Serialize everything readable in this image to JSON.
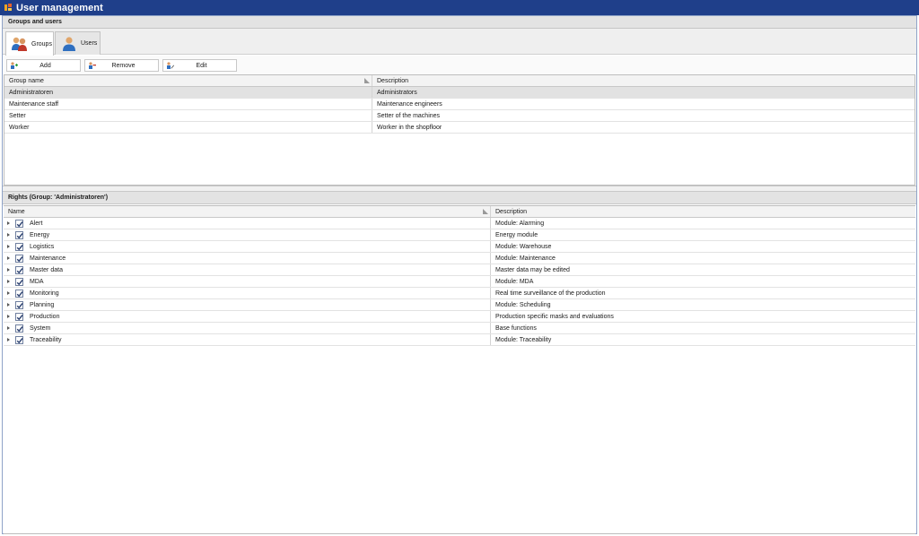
{
  "window": {
    "title": "User management"
  },
  "groups_section": {
    "header": "Groups and users"
  },
  "tabs": [
    {
      "label": "Groups",
      "icon": "users-group-icon"
    },
    {
      "label": "Users",
      "icon": "user-icon"
    }
  ],
  "toolbar": {
    "add_label": "Add",
    "remove_label": "Remove",
    "edit_label": "Edit"
  },
  "groups_table": {
    "columns": [
      "Group name",
      "Description"
    ],
    "rows": [
      {
        "name": "Administratoren",
        "description": "Administrators"
      },
      {
        "name": "Maintenance staff",
        "description": "Maintenance engineers"
      },
      {
        "name": "Setter",
        "description": "Setter of the machines"
      },
      {
        "name": "Worker",
        "description": "Worker in the shopfloor"
      }
    ]
  },
  "rights_section": {
    "header": "Rights (Group: 'Administratoren')"
  },
  "rights_table": {
    "columns": [
      "Name",
      "Description"
    ],
    "rows": [
      {
        "name": "Alert",
        "description": "Module: Alarming"
      },
      {
        "name": "Energy",
        "description": "Energy module"
      },
      {
        "name": "Logistics",
        "description": "Module: Warehouse"
      },
      {
        "name": "Maintenance",
        "description": "Module: Maintenance"
      },
      {
        "name": "Master data",
        "description": "Master data may be edited"
      },
      {
        "name": "MDA",
        "description": "Module: MDA"
      },
      {
        "name": "Monitoring",
        "description": "Real time surveillance of the production"
      },
      {
        "name": "Planning",
        "description": "Module: Scheduling"
      },
      {
        "name": "Production",
        "description": "Production specific masks and evaluations"
      },
      {
        "name": "System",
        "description": "Base functions"
      },
      {
        "name": "Traceability",
        "description": "Module: Traceability"
      }
    ]
  },
  "colors": {
    "titlebar": "#1f3f8a",
    "selected_row": "#e2e2e2",
    "header_bg": "#e3e3e3"
  }
}
